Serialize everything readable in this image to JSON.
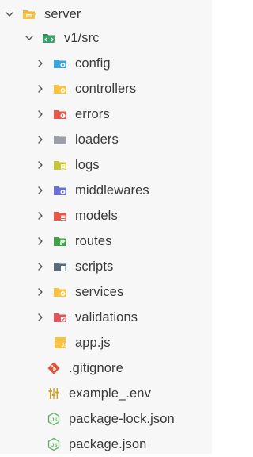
{
  "tree": {
    "root": {
      "label": "server",
      "icon": "folder-open-icon",
      "expanded": true
    },
    "v1": {
      "label": "v1/src",
      "icon": "folder-open-icon",
      "expanded": true
    },
    "folders": [
      {
        "label": "config",
        "icon": "folder-config-icon",
        "color": "#3aa6d8"
      },
      {
        "label": "controllers",
        "icon": "folder-controllers-icon",
        "color": "#f6c343"
      },
      {
        "label": "errors",
        "icon": "folder-errors-icon",
        "color": "#e4574a"
      },
      {
        "label": "loaders",
        "icon": "folder-loaders-icon",
        "color": "#9aa0a6"
      },
      {
        "label": "logs",
        "icon": "folder-logs-icon",
        "color": "#c6c63a"
      },
      {
        "label": "middlewares",
        "icon": "folder-middlewares-icon",
        "color": "#6b6fd6"
      },
      {
        "label": "models",
        "icon": "folder-models-icon",
        "color": "#e4574a"
      },
      {
        "label": "routes",
        "icon": "folder-routes-icon",
        "color": "#43a047"
      },
      {
        "label": "scripts",
        "icon": "folder-scripts-icon",
        "color": "#5a6b7a"
      },
      {
        "label": "services",
        "icon": "folder-services-icon",
        "color": "#f6c343"
      },
      {
        "label": "validations",
        "icon": "folder-validations-icon",
        "color": "#e0555c"
      }
    ],
    "files": [
      {
        "label": "app.js",
        "icon": "js-file-icon",
        "color": "#f6c343"
      },
      {
        "label": ".gitignore",
        "icon": "git-icon",
        "color": "#e0553b"
      },
      {
        "label": "example_.env",
        "icon": "env-file-icon",
        "color": "#d4a21a"
      },
      {
        "label": "package-lock.json",
        "icon": "npm-json-icon",
        "color": "#62b36a"
      },
      {
        "label": "package.json",
        "icon": "npm-json-icon",
        "color": "#62b36a"
      }
    ]
  }
}
